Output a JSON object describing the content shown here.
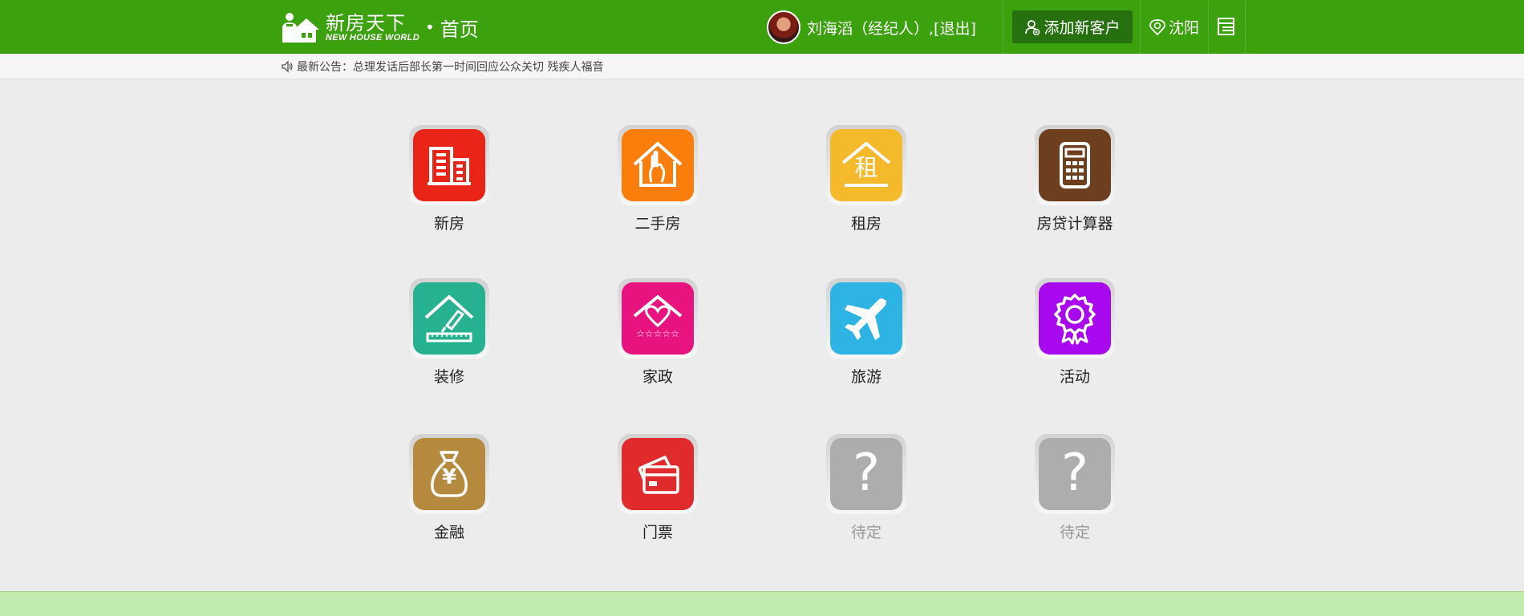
{
  "header": {
    "brand_cn": "新房天下",
    "brand_en": "NEW HOUSE WORLD",
    "brand_dot": "•",
    "page_name": "首页",
    "user_text": "刘海滔（经纪人）,",
    "logout": "[退出]",
    "add_customer": "添加新客户",
    "city": "沈阳",
    "colors": {
      "bar": "#3ba10c",
      "button": "#267010"
    }
  },
  "notice": {
    "text": "最新公告：总理发话后部长第一时间回应公众关切 残疾人福音"
  },
  "menu": [
    {
      "label": "新房",
      "icon": "building-icon",
      "color": "#ea2416"
    },
    {
      "label": "二手房",
      "icon": "house-hand-icon",
      "color": "#fb7e0c"
    },
    {
      "label": "租房",
      "icon": "rent-house-icon",
      "color": "#f5b92c",
      "icon_text": "租"
    },
    {
      "label": "房贷计算器",
      "icon": "calculator-icon",
      "color": "#6e3f1f"
    },
    {
      "label": "装修",
      "icon": "renovation-icon",
      "color": "#26b191"
    },
    {
      "label": "家政",
      "icon": "housekeeping-icon",
      "color": "#e8137f",
      "icon_text": "☆☆☆☆☆"
    },
    {
      "label": "旅游",
      "icon": "airplane-icon",
      "color": "#2db4e4"
    },
    {
      "label": "活动",
      "icon": "badge-icon",
      "color": "#a708ef"
    },
    {
      "label": "金融",
      "icon": "money-bag-icon",
      "color": "#b68a3e",
      "icon_text": "¥"
    },
    {
      "label": "门票",
      "icon": "ticket-icon",
      "color": "#e12a2c"
    },
    {
      "label": "待定",
      "icon": "question-icon",
      "color": "#adadad",
      "icon_text": "?",
      "pending": true
    },
    {
      "label": "待定",
      "icon": "question-icon",
      "color": "#adadad",
      "icon_text": "?",
      "pending": true
    }
  ]
}
